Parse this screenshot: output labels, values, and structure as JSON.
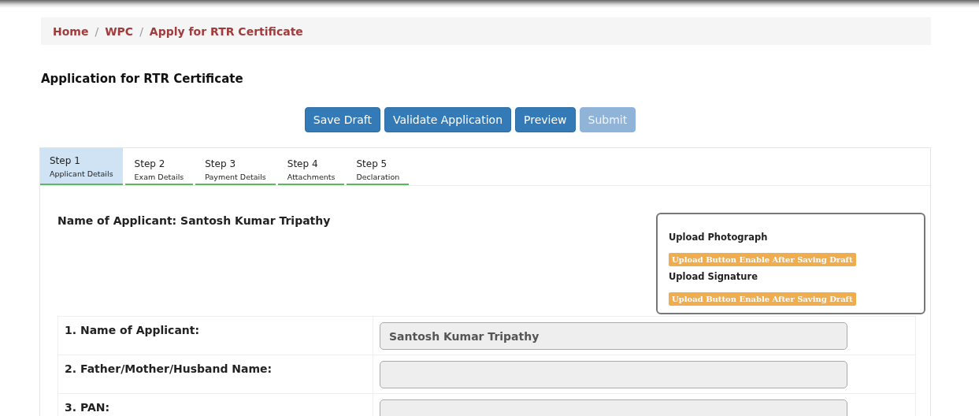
{
  "breadcrumb": [
    "Home",
    "WPC",
    "Apply for RTR Certificate"
  ],
  "breadcrumb_separator": "/",
  "page_title": "Application for RTR Certificate",
  "actions": [
    {
      "label": "Save Draft",
      "disabled": false
    },
    {
      "label": "Validate Application",
      "disabled": false
    },
    {
      "label": "Preview",
      "disabled": false
    },
    {
      "label": "Submit",
      "disabled": true
    }
  ],
  "steps": [
    {
      "title": "Step 1",
      "subtitle": "Applicant Details",
      "selected": true
    },
    {
      "title": "Step 2",
      "subtitle": "Exam Details",
      "selected": false
    },
    {
      "title": "Step 3",
      "subtitle": "Payment Details",
      "selected": false
    },
    {
      "title": "Step 4",
      "subtitle": "Attachments",
      "selected": false
    },
    {
      "title": "Step 5",
      "subtitle": "Declaration",
      "selected": false
    }
  ],
  "applicant_heading": "Name of Applicant: Santosh Kumar Tripathy",
  "uploads": [
    {
      "label": "Upload Photograph",
      "notice": "Upload Button Enable After Saving Draft"
    },
    {
      "label": "Upload Signature",
      "notice": "Upload Button Enable After Saving Draft"
    }
  ],
  "form_rows": [
    {
      "label": "1. Name of Applicant:",
      "value": "Santosh Kumar Tripathy"
    },
    {
      "label": "2. Father/Mother/Husband Name:",
      "value": ""
    },
    {
      "label": "3. PAN:"
    }
  ]
}
